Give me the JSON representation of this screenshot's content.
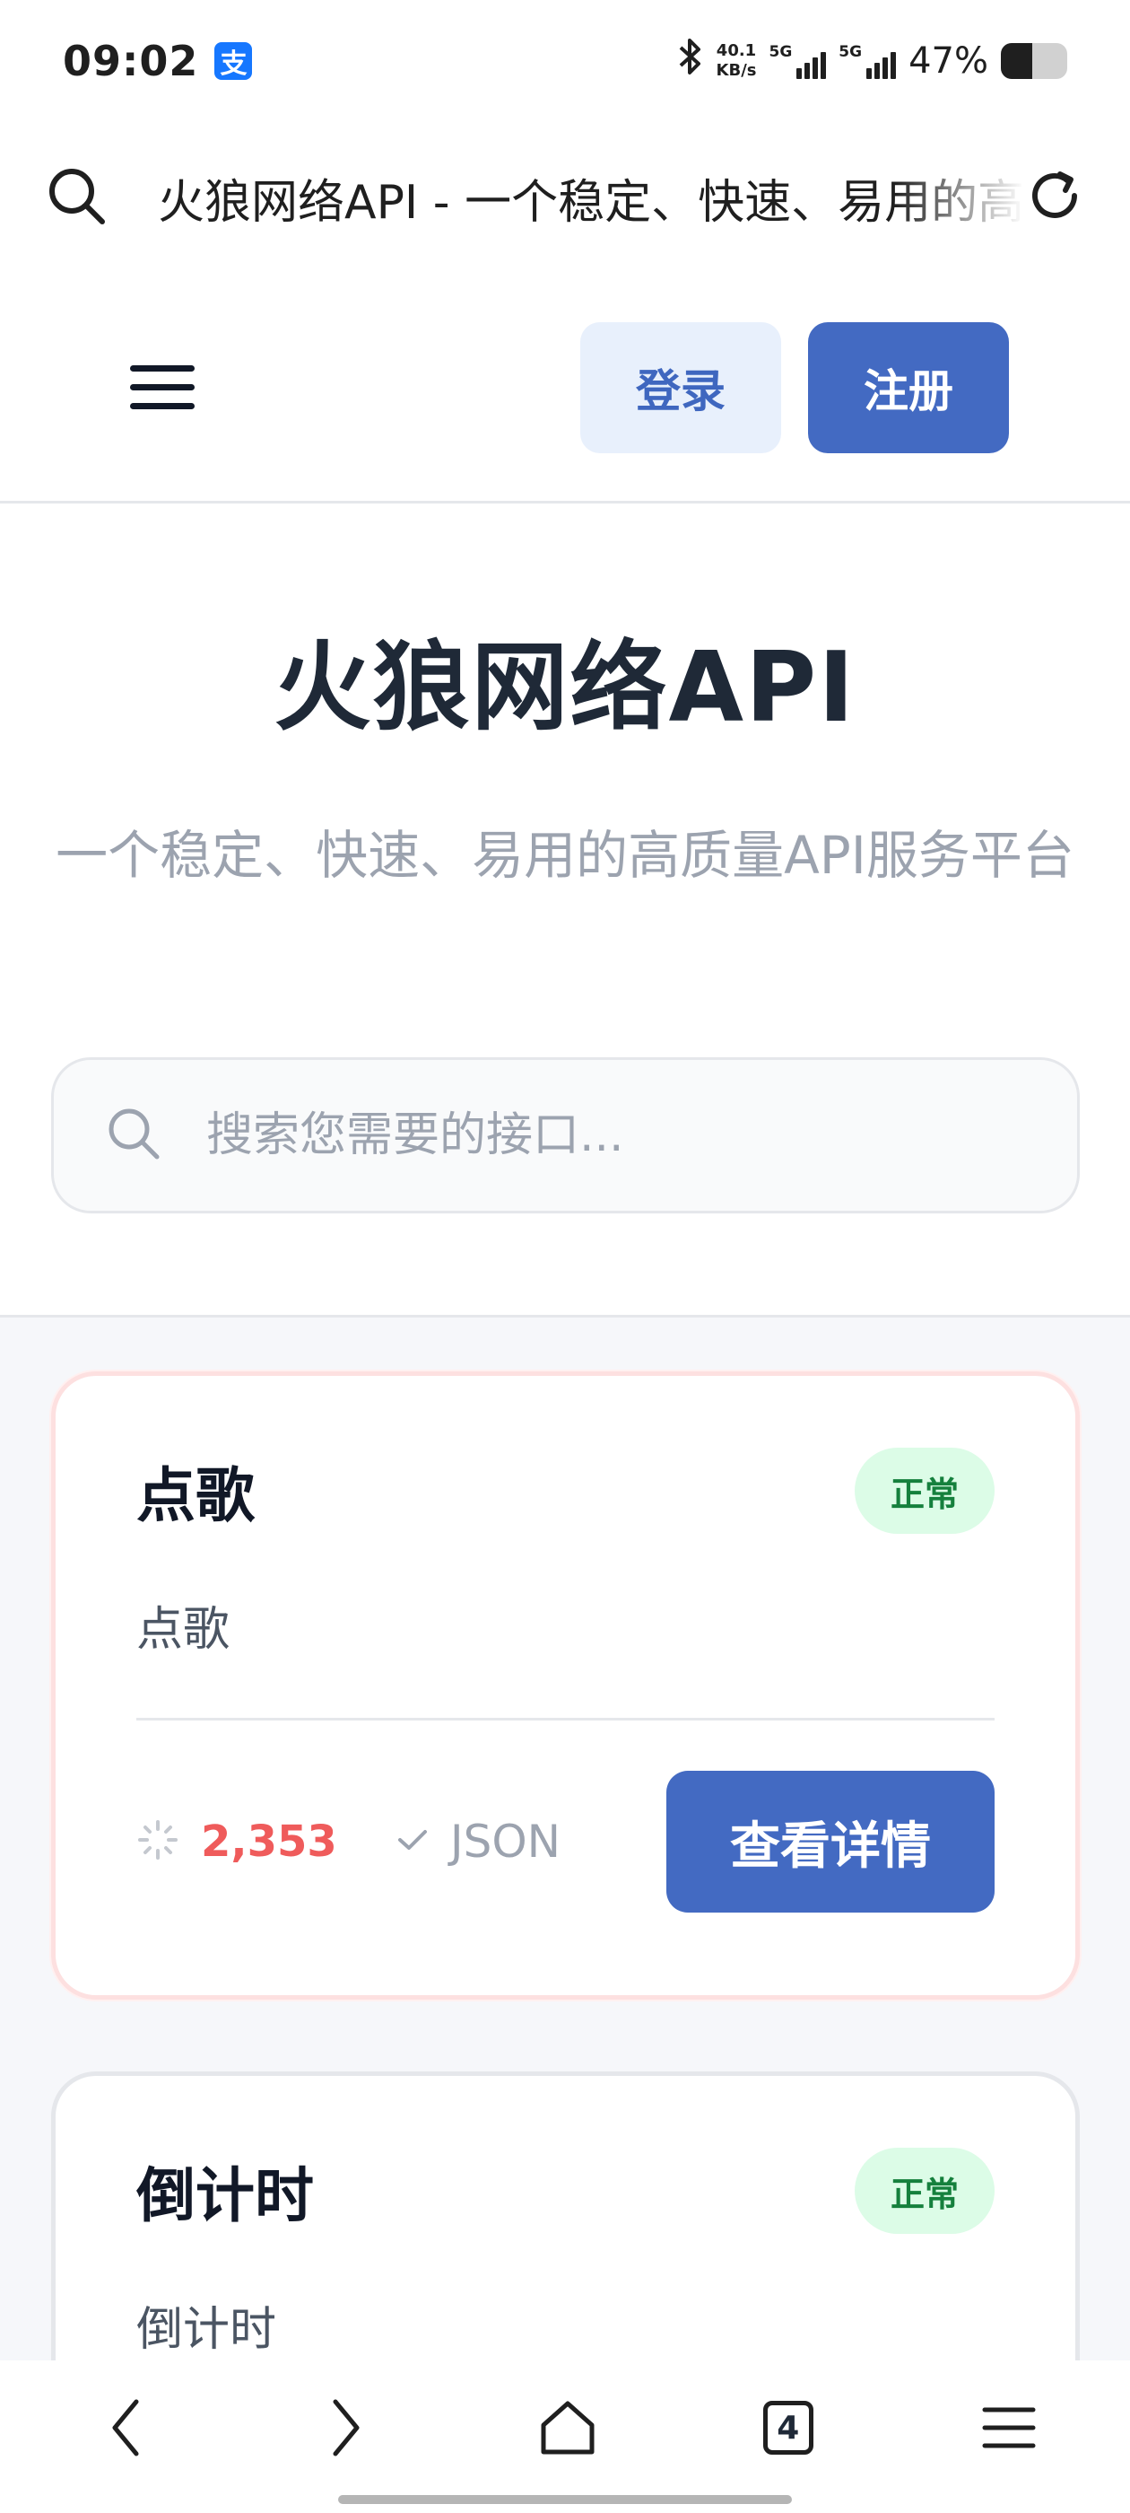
{
  "status_bar": {
    "time": "09:02",
    "alipay_glyph": "支",
    "net_speed_value": "40.1",
    "net_speed_unit": "KB/s",
    "signal1_label": "5G",
    "signal2_label": "5G",
    "battery_text": "47%",
    "battery_level": 0.47,
    "bluetooth_icon": "bluetooth-icon"
  },
  "address_bar": {
    "page_title": "火狼网络API - 一个稳定、快速、易用的高质量API服务平台"
  },
  "header": {
    "login_label": "登录",
    "register_label": "注册"
  },
  "hero": {
    "title": "火狼网络API",
    "subtitle": "一个稳定、快速、易用的高质量API服务平台",
    "search_placeholder": "搜索您需要的接口..."
  },
  "api_cards": [
    {
      "title": "点歌",
      "status": "正常",
      "description": "点歌",
      "calls": "2,353",
      "format": "JSON",
      "detail_label": "查看详情"
    },
    {
      "title": "倒计时",
      "status": "正常",
      "description": "倒计时"
    }
  ],
  "bottom_nav": {
    "tab_count": "4"
  },
  "colors": {
    "primary": "#436ac2",
    "primary_light": "#e8f0fc",
    "status_green_bg": "#dcfce7",
    "status_green_text": "#15803d",
    "calls_red": "#ef5b5b"
  }
}
